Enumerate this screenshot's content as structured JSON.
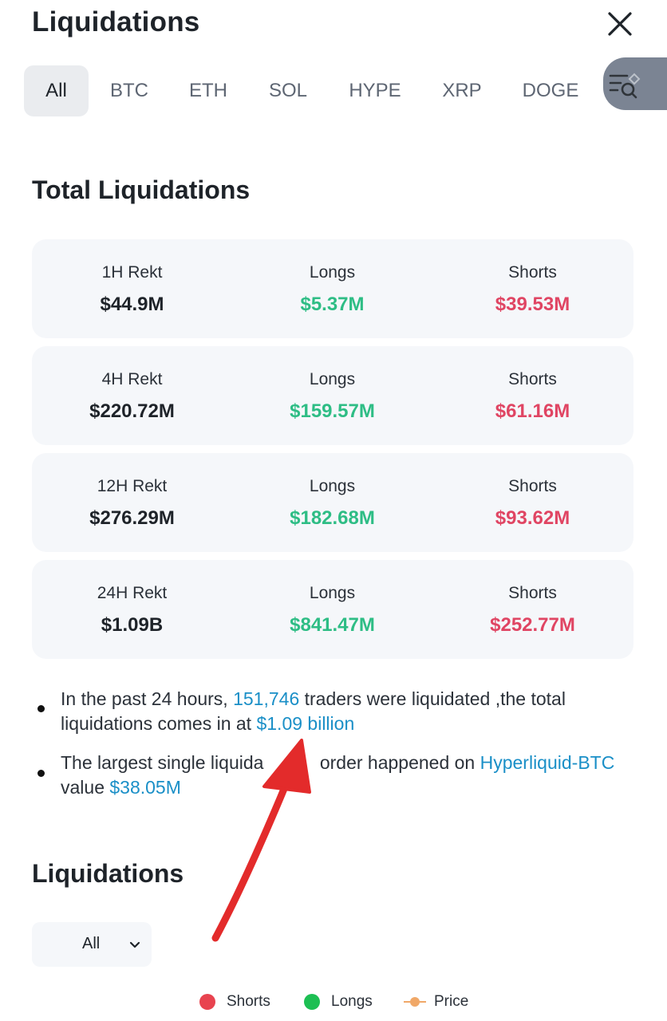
{
  "header": {
    "title": "Liquidations",
    "close_icon": "close-icon"
  },
  "tabs": [
    "All",
    "BTC",
    "ETH",
    "SOL",
    "HYPE",
    "XRP",
    "DOGE"
  ],
  "active_tab": "All",
  "filter_icon": "filter-search-icon",
  "total": {
    "title": "Total Liquidations",
    "rows": [
      {
        "period": "1H Rekt",
        "total": "$44.9M",
        "longs_label": "Longs",
        "longs": "$5.37M",
        "shorts_label": "Shorts",
        "shorts": "$39.53M"
      },
      {
        "period": "4H Rekt",
        "total": "$220.72M",
        "longs_label": "Longs",
        "longs": "$159.57M",
        "shorts_label": "Shorts",
        "shorts": "$61.16M"
      },
      {
        "period": "12H Rekt",
        "total": "$276.29M",
        "longs_label": "Longs",
        "longs": "$182.68M",
        "shorts_label": "Shorts",
        "shorts": "$93.62M"
      },
      {
        "period": "24H Rekt",
        "total": "$1.09B",
        "longs_label": "Longs",
        "longs": "$841.47M",
        "shorts_label": "Shorts",
        "shorts": "$252.77M"
      }
    ]
  },
  "summary": {
    "line1_prefix": "In the past 24 hours, ",
    "traders": "151,746",
    "line1_mid": " traders were liquidated ,the total liquidations comes in at ",
    "amount": "$1.09 billion",
    "line2_prefix": "The largest single liquida",
    "line2_mid": " order happened on ",
    "pair": "Hyperliquid-BTC",
    "line2_value_prefix": " value ",
    "value": "$38.05M"
  },
  "chart_section": {
    "title": "Liquidations",
    "select_value": "All",
    "legend": [
      {
        "label": "Shorts",
        "color": "#e8434f"
      },
      {
        "label": "Longs",
        "color": "#1dbf53"
      },
      {
        "label": "Price",
        "color": "#f0a868"
      }
    ]
  },
  "colors": {
    "green": "#2ebd85",
    "red": "#e04563",
    "link": "#1a8fc7",
    "annotation_arrow": "#e32b2b"
  }
}
